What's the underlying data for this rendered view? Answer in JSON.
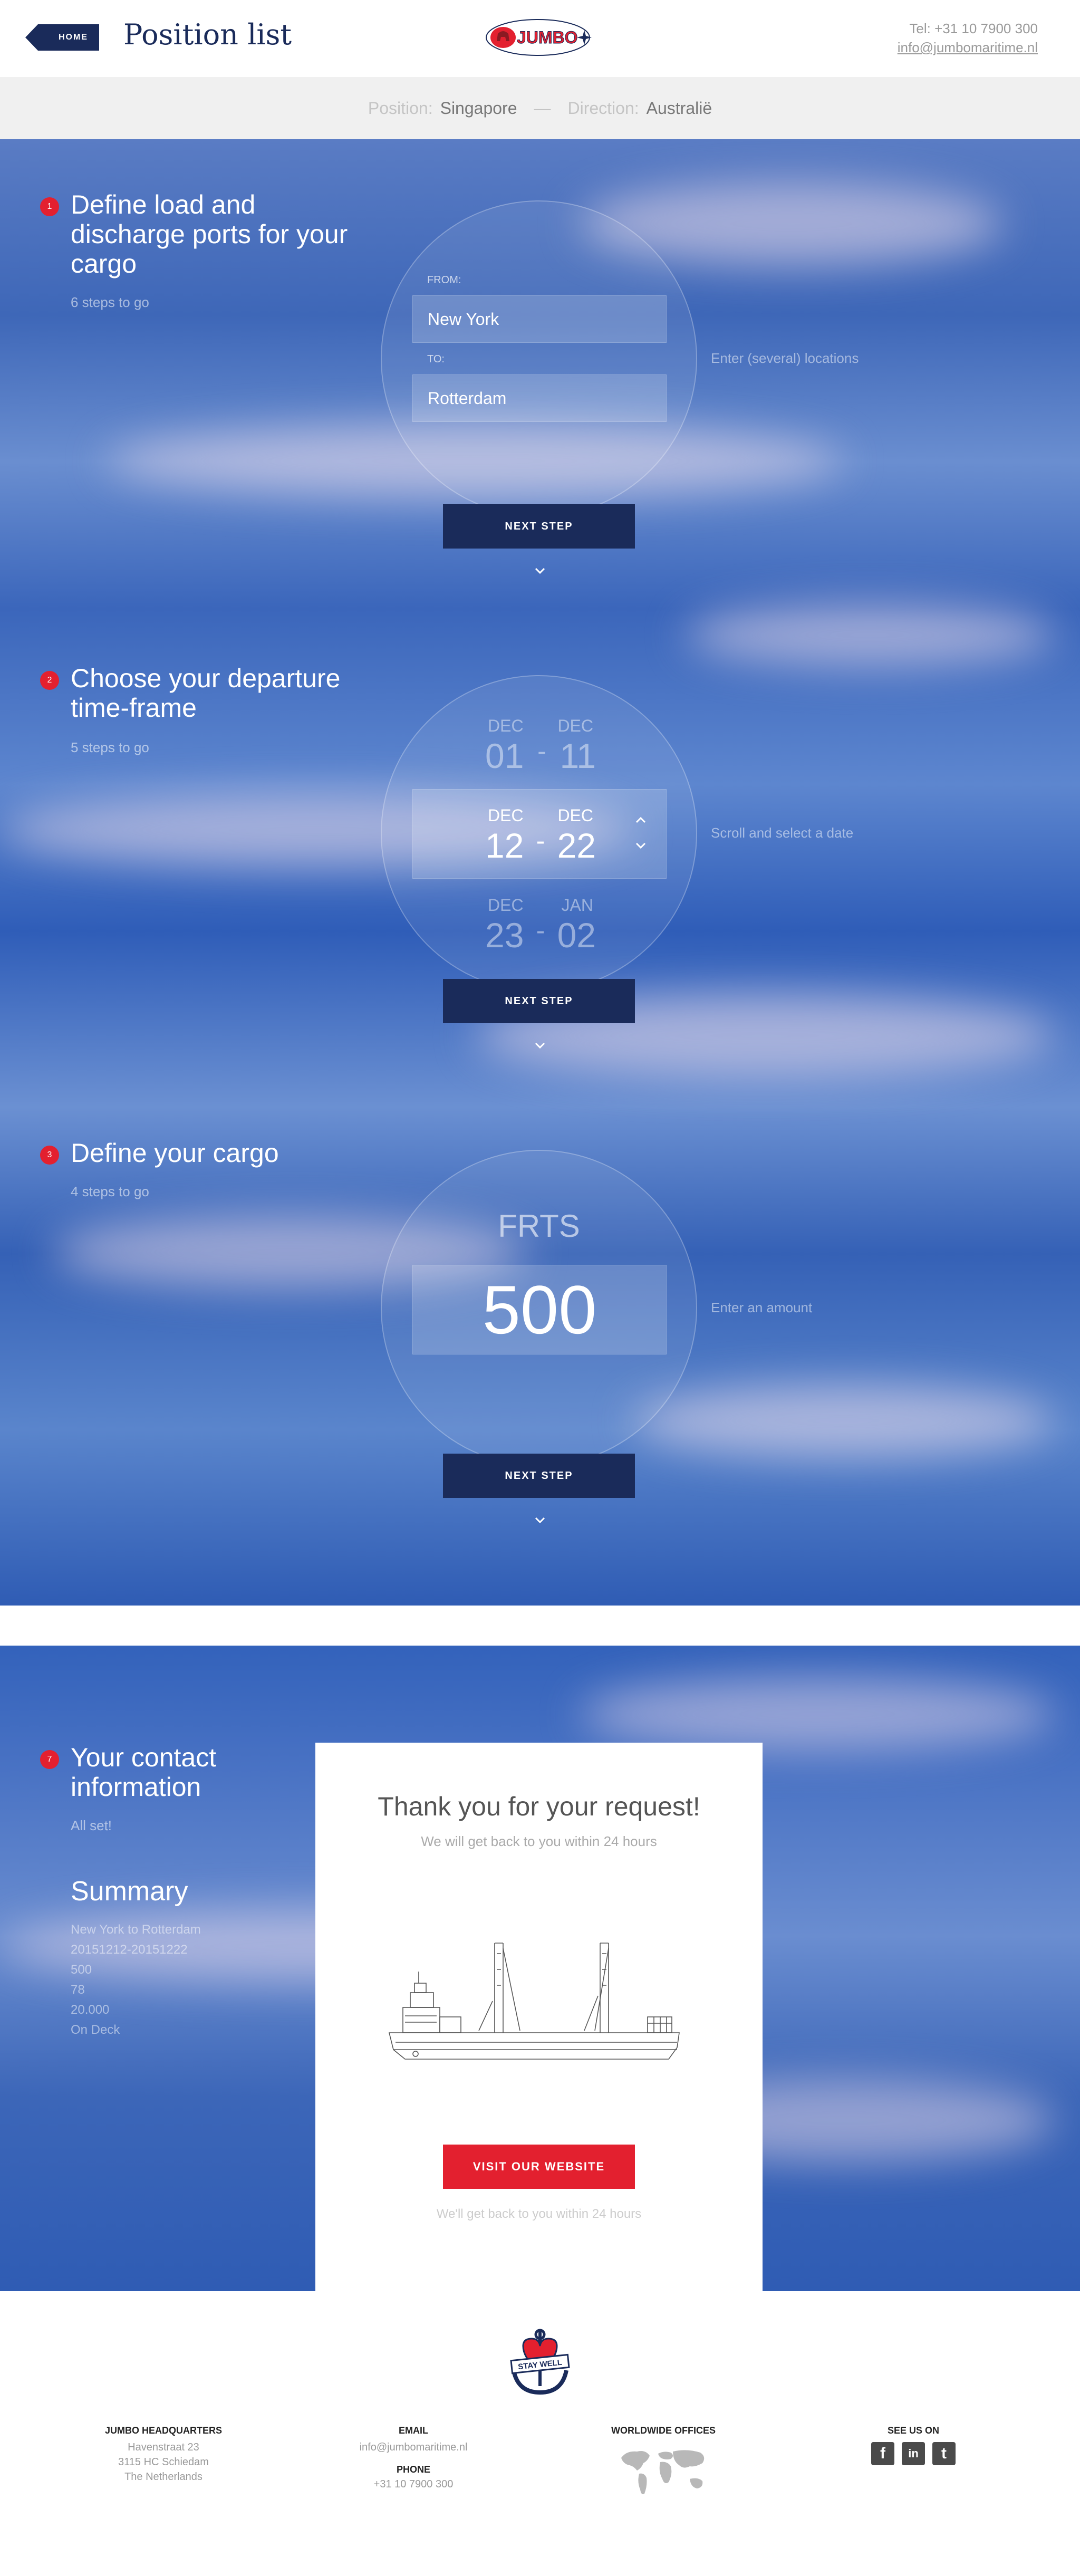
{
  "header": {
    "home_label": "HOME",
    "title": "Position list",
    "logo_text": "JUMBO",
    "tel": "Tel: +31 10 7900 300",
    "email": "info@jumbomaritime.nl"
  },
  "breadcrumb": {
    "position_label": "Position:",
    "position_value": "Singapore",
    "separator": "—",
    "direction_label": "Direction:",
    "direction_value": "Australië"
  },
  "steps": [
    {
      "number": "1",
      "title": "Define load and discharge ports for your cargo",
      "subtitle": "6 steps to go",
      "from_label": "FROM:",
      "from_value": "New York",
      "to_label": "TO:",
      "to_value": "Rotterdam",
      "hint": "Enter (several) locations",
      "button": "NEXT STEP"
    },
    {
      "number": "2",
      "title": "Choose your departure time-frame",
      "subtitle": "5 steps to go",
      "rows": [
        {
          "m1": "DEC",
          "d1": "01",
          "m2": "DEC",
          "d2": "11"
        },
        {
          "m1": "DEC",
          "d1": "12",
          "m2": "DEC",
          "d2": "22"
        },
        {
          "m1": "DEC",
          "d1": "23",
          "m2": "JAN",
          "d2": "02"
        }
      ],
      "dash": "-",
      "hint": "Scroll and select a date",
      "button": "NEXT STEP"
    },
    {
      "number": "3",
      "title": "Define your cargo",
      "subtitle": "4 steps to go",
      "unit": "FRTS",
      "amount": "500",
      "hint": "Enter an amount",
      "button": "NEXT STEP"
    }
  ],
  "contact": {
    "number": "7",
    "title": "Your contact information",
    "subtitle": "All set!"
  },
  "summary": {
    "title": "Summary",
    "items": [
      "New York to Rotterdam",
      "20151212-20151222",
      "500",
      "78",
      "20.000",
      "On Deck"
    ]
  },
  "thankyou": {
    "title": "Thank you for your request!",
    "subtitle": "We will get back to you within 24 hours",
    "button": "VISIT OUR WEBSITE",
    "footnote": "We'll get back to you within 24 hours"
  },
  "footer": {
    "badge_text": "STAY WELL",
    "hq_heading": "JUMBO HEADQUARTERS",
    "hq_lines": [
      "Havenstraat 23",
      "3115 HC Schiedam",
      "The Netherlands"
    ],
    "email_heading": "EMAIL",
    "email_value": "info@jumbomaritime.nl",
    "phone_heading": "PHONE",
    "phone_value": "+31 10 7900 300",
    "offices_heading": "WORLDWIDE OFFICES",
    "social_heading": "SEE US ON",
    "social": [
      {
        "icon": "facebook-icon",
        "glyph": "f"
      },
      {
        "icon": "linkedin-icon",
        "glyph": "in"
      },
      {
        "icon": "twitter-icon",
        "glyph": "t"
      }
    ]
  },
  "colors": {
    "navy": "#1a2b5a",
    "red": "#e3202f",
    "ocean": "#3e67b8"
  }
}
